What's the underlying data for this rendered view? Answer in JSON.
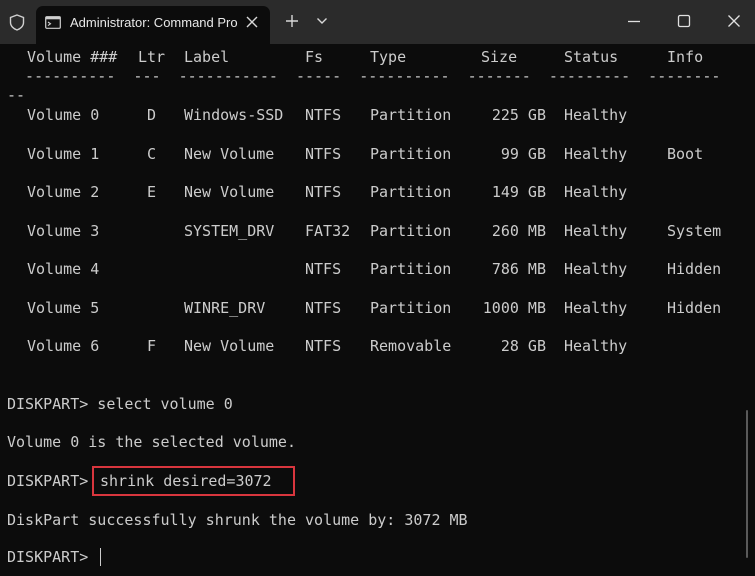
{
  "window": {
    "tab_title": "Administrator: Command Pro"
  },
  "table": {
    "headers": [
      "Volume ###",
      "Ltr",
      "Label",
      "Fs",
      "Type",
      "Size",
      "Status",
      "Info"
    ],
    "separator": "  ----------  ---  -----------  -----  ----------  -------  ---------  --------",
    "separator_wrap": "--",
    "rows": [
      {
        "volume": "Volume 0",
        "ltr": "D",
        "label": "Windows-SSD",
        "fs": "NTFS",
        "type": "Partition",
        "size": "225 GB",
        "status": "Healthy",
        "info": ""
      },
      {
        "volume": "Volume 1",
        "ltr": "C",
        "label": "New Volume",
        "fs": "NTFS",
        "type": "Partition",
        "size": "99 GB",
        "status": "Healthy",
        "info": "Boot"
      },
      {
        "volume": "Volume 2",
        "ltr": "E",
        "label": "New Volume",
        "fs": "NTFS",
        "type": "Partition",
        "size": "149 GB",
        "status": "Healthy",
        "info": ""
      },
      {
        "volume": "Volume 3",
        "ltr": "",
        "label": "SYSTEM_DRV",
        "fs": "FAT32",
        "type": "Partition",
        "size": "260 MB",
        "status": "Healthy",
        "info": "System"
      },
      {
        "volume": "Volume 4",
        "ltr": "",
        "label": "",
        "fs": "NTFS",
        "type": "Partition",
        "size": "786 MB",
        "status": "Healthy",
        "info": "Hidden"
      },
      {
        "volume": "Volume 5",
        "ltr": "",
        "label": "WINRE_DRV",
        "fs": "NTFS",
        "type": "Partition",
        "size": "1000 MB",
        "status": "Healthy",
        "info": "Hidden"
      },
      {
        "volume": "Volume 6",
        "ltr": "F",
        "label": "New Volume",
        "fs": "NTFS",
        "type": "Removable",
        "size": "28 GB",
        "status": "Healthy",
        "info": ""
      }
    ]
  },
  "console": {
    "cmd1": "DISKPART> select volume 0",
    "out1": "Volume 0 is the selected volume.",
    "prompt2": "DISKPART> ",
    "cmd2": "shrink desired=3072",
    "out2": "DiskPart successfully shrunk the volume by: 3072 MB",
    "prompt3": "DISKPART> "
  },
  "colors": {
    "background": "#0c0c0c",
    "text": "#cccccc",
    "titlebar": "#2b2b2b",
    "highlight_border": "#d9363e"
  },
  "icons": {
    "shield": "shield-icon",
    "tab": "terminal-icon",
    "close_tab": "close-icon",
    "new_tab": "plus-icon",
    "dropdown": "chevron-down-icon",
    "minimize": "minimize-icon",
    "maximize": "maximize-icon",
    "close_window": "close-icon"
  }
}
